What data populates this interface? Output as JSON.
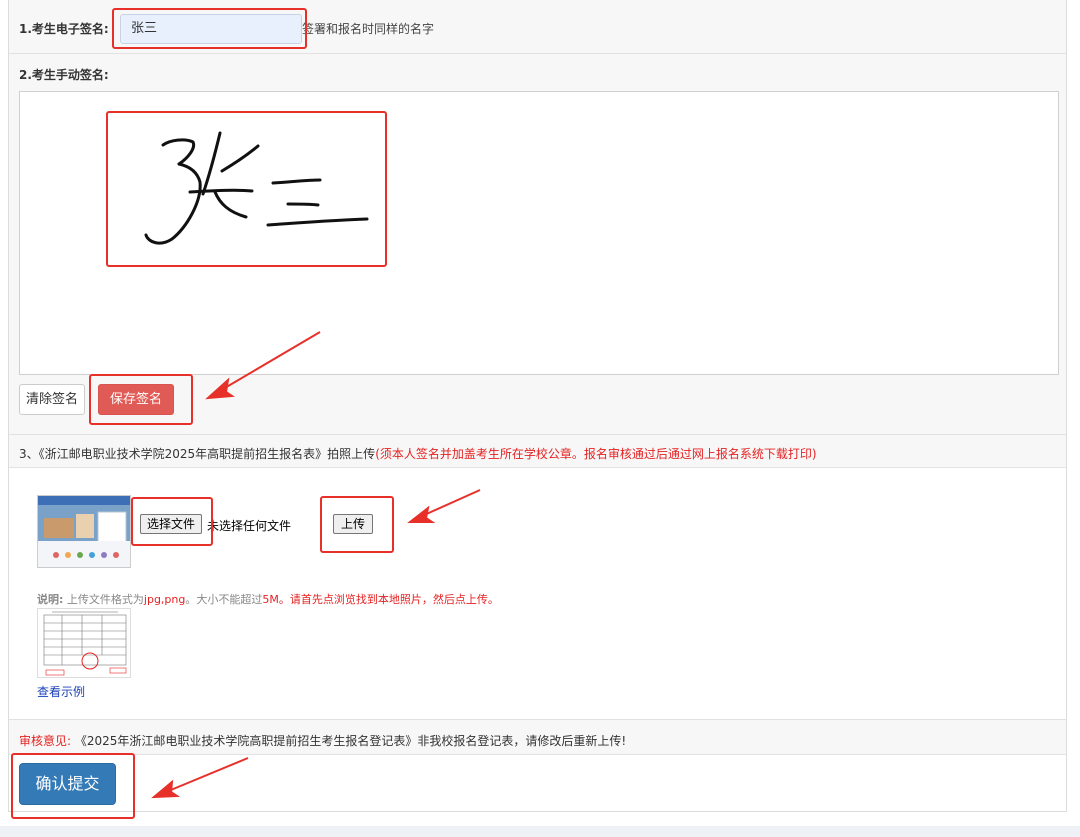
{
  "esign": {
    "label": "1.考生电子签名:",
    "value": "张三",
    "hint": "签署和报名时同样的名字"
  },
  "handsign": {
    "label": "2.考生手动签名:",
    "clear_label": "清除签名",
    "save_label": "保存签名"
  },
  "upload": {
    "title_prefix": "3、《浙江邮电职业技术学院2025年高职提前招生报名表》拍照上传",
    "title_note": "(须本人签名并加盖考生所在学校公章。报名审核通过后通过网上报名系统下载打印)",
    "choose_file_label": "选择文件",
    "no_file_text": "未选择任何文件",
    "upload_label": "上传",
    "note_label": "说明:",
    "note_text_1": "上传文件格式为",
    "note_format": "jpg,png",
    "note_text_2": "。大小不能超过",
    "note_size": "5M",
    "note_text_3": "。请首先点浏览找到本地照片，然后点上传。",
    "example_link": "查看示例"
  },
  "review": {
    "label": "审核意见:",
    "text": "《2025年浙江邮电职业技术学院高职提前招生考生报名登记表》非我校报名登记表，请修改后重新上传!"
  },
  "submit_label": "确认提交",
  "colors": {
    "annotation_red": "#e8302a",
    "danger_button": "#e05b55",
    "primary_button": "#337ab7",
    "warning_text": "#e52222",
    "input_bg": "#e8f0fe"
  }
}
